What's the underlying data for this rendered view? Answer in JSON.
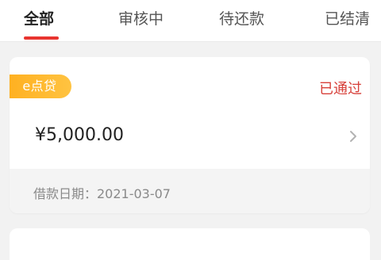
{
  "tabs": [
    {
      "label": "全部",
      "active": true
    },
    {
      "label": "审核中",
      "active": false
    },
    {
      "label": "待还款",
      "active": false
    },
    {
      "label": "已结清",
      "active": false
    }
  ],
  "colors": {
    "accent_red": "#e8342f",
    "status_red": "#d7403a",
    "badge_orange": "#ffb020"
  },
  "loan_card": {
    "badge": "e点贷",
    "status": "已通过",
    "amount": "¥5,000.00",
    "date_text": "借款日期：2021-03-07",
    "chevron_icon": "chevron-right-icon"
  }
}
